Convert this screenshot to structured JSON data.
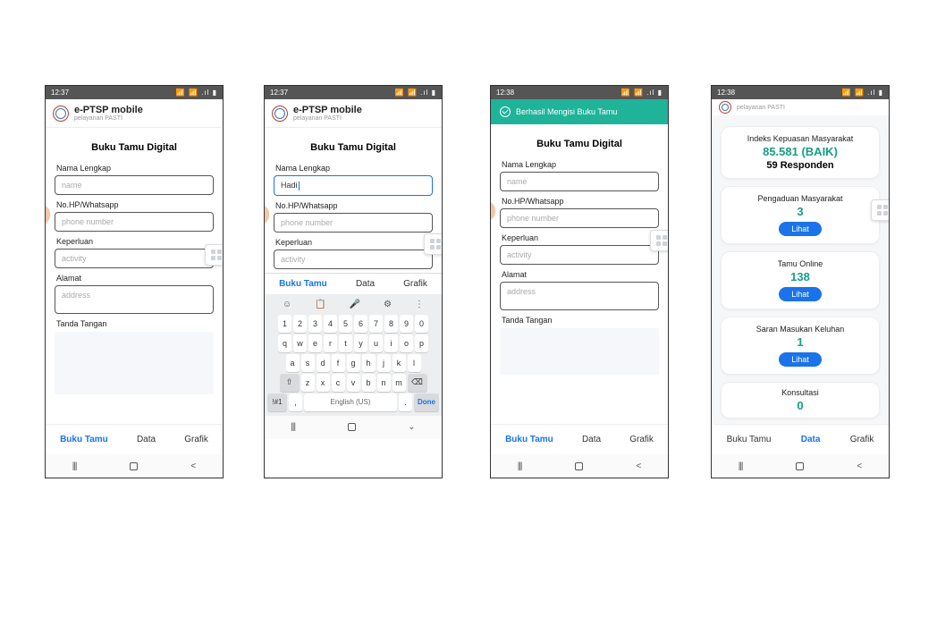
{
  "status": {
    "time1": "12:37",
    "time2": "12:38",
    "icons": "▣ ◙ ▯",
    "signal": "📶 📶 .ıl ▮"
  },
  "app": {
    "title": "e-PTSP mobile",
    "subtitle": "pelayanan PASTI"
  },
  "form": {
    "section": "Buku Tamu Digital",
    "nameLabel": "Nama Lengkap",
    "namePh": "name",
    "phoneLabel": "No.HP/Whatsapp",
    "phonePh": "phone number",
    "needLabel": "Keperluan",
    "needPh": "activity",
    "addrLabel": "Alamat",
    "addrPh": "address",
    "sigLabel": "Tanda Tangan",
    "typedName": "Hadi"
  },
  "tabs": {
    "t1": "Buku Tamu",
    "t2": "Data",
    "t3": "Grafik"
  },
  "success": "Berhasil Mengisi Buku Tamu",
  "kb": {
    "nums": [
      "1",
      "2",
      "3",
      "4",
      "5",
      "6",
      "7",
      "8",
      "9",
      "0"
    ],
    "r1": [
      "q",
      "w",
      "e",
      "r",
      "t",
      "y",
      "u",
      "i",
      "o",
      "p"
    ],
    "r2": [
      "a",
      "s",
      "d",
      "f",
      "g",
      "h",
      "j",
      "k",
      "l"
    ],
    "r3": [
      "z",
      "x",
      "c",
      "v",
      "b",
      "n",
      "m"
    ],
    "shift": "⇧",
    "bksp": "⌫",
    "sym": "!#1",
    "comma": ",",
    "lang": "English (US)",
    "dot": ".",
    "done": "Done",
    "tool": [
      "☺",
      "📋",
      "🎤",
      "⚙",
      "⋮"
    ]
  },
  "dash": {
    "ikm_t": "Indeks Kepuasan Masyarakat",
    "ikm_v": "85.581 (BAIK)",
    "ikm_r": "59 Responden",
    "c1_t": "Pengaduan Masyarakat",
    "c1_v": "3",
    "c2_t": "Tamu Online",
    "c2_v": "138",
    "c3_t": "Saran Masukan Keluhan",
    "c3_v": "1",
    "c4_t": "Konsultasi",
    "c4_v": "0",
    "lihat": "Lihat"
  }
}
